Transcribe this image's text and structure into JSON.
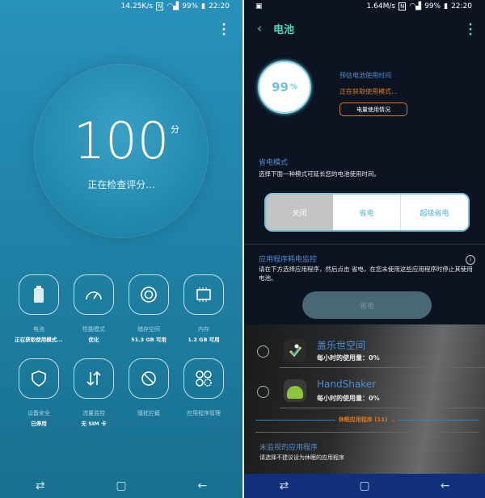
{
  "left": {
    "status": {
      "speed": "14.25K/s",
      "nfc": "N",
      "battery": "99%",
      "time": "22:20"
    },
    "score": "100",
    "score_unit": "分",
    "checking": "正在检查评分...",
    "tiles": [
      {
        "icon": "battery-icon",
        "label": "电池",
        "sub": "正在获取使用模式..."
      },
      {
        "icon": "speedometer-icon",
        "label": "性能模式",
        "sub": "优化"
      },
      {
        "icon": "storage-icon",
        "label": "储存空间",
        "sub": "51.3 GB 可用"
      },
      {
        "icon": "memory-chip-icon",
        "label": "内存",
        "sub": "1.2 GB 可用"
      },
      {
        "icon": "shield-icon",
        "label": "设备安全",
        "sub": "已停用"
      },
      {
        "icon": "data-transfer-icon",
        "label": "流量监控",
        "sub": "无 SIM 卡"
      },
      {
        "icon": "block-icon",
        "label": "骚扰拦截",
        "sub": ""
      },
      {
        "icon": "apps-gear-icon",
        "label": "应用程序管理",
        "sub": ""
      }
    ]
  },
  "right": {
    "status": {
      "speed": "1.64M/s",
      "nfc": "N",
      "battery": "99%",
      "time": "22:20"
    },
    "title": "电池",
    "battery_percent": "99",
    "percent_sign": "%",
    "estimate_label": "预估电池使用时间",
    "getting_mode": "正在获取使用模式...",
    "usage_button": "电量使用情况",
    "power_saving": {
      "title": "省电模式",
      "desc": "选择下面一种模式可延长您的电池使用时间。",
      "options": [
        "关闭",
        "省电",
        "超级省电"
      ],
      "selected": "关闭"
    },
    "app_monitor": {
      "title": "应用程序耗电监控",
      "desc": "请在下方选择应用程序，然后点击 省电，在您未使用这些应用程序时停止其使用电池。",
      "save_button": "省电"
    },
    "apps": [
      {
        "name": "盖乐世空间",
        "usage": "每小时的使用量：0%"
      },
      {
        "name": "HandShaker",
        "usage": "每小时的使用量：0%"
      }
    ],
    "sleeping_apps": "休眠应用程序 (11)",
    "unmonitored": {
      "title": "未监视的应用程序",
      "desc": "请选择不建议设为休眠的应用程序"
    }
  },
  "colors": {
    "left_bg": "#2891bb",
    "accent_blue": "#4a8ed6",
    "accent_orange": "#e07a1a",
    "header_green": "#4fd6b2"
  }
}
